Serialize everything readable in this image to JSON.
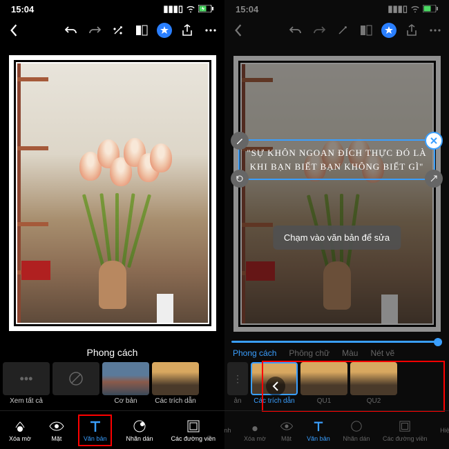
{
  "left": {
    "status": {
      "time": "15:04"
    },
    "section_title": "Phong cách",
    "styles": [
      {
        "label": "Xem tất cả",
        "icon": "···"
      },
      {
        "label": "",
        "icon": "⊘"
      },
      {
        "label": "Cơ bản"
      },
      {
        "label": "Các trích dẫn"
      }
    ],
    "nav": {
      "xoamo": "Xóa mờ",
      "mat": "Mặt",
      "vanban": "Văn bản",
      "nhandan": "Nhãn dán",
      "duongvien": "Các đường viền"
    }
  },
  "right": {
    "status": {
      "time": "15:04"
    },
    "quote": "\"SỰ KHÔN NGOAN ĐÍCH THỰC ĐÓ LÀ KHI BẠN BIẾT BẠN KHÔNG BIẾT GÌ\"",
    "tooltip": "Chạm vào văn bản để sửa",
    "tabs": {
      "phongcach": "Phong cách",
      "phongchu": "Phông chữ",
      "mau": "Màu",
      "netve": "Nét vẽ"
    },
    "styles": [
      {
        "label": "ản"
      },
      {
        "label": "Các trích dẫn"
      },
      {
        "label": "QU1"
      },
      {
        "label": "QU2"
      }
    ],
    "nav": {
      "nh": "nh",
      "xoamo": "Xóa mờ",
      "mat": "Mặt",
      "vanban": "Văn bản",
      "nhandan": "Nhãn dán",
      "duongvien": "Các đường viền",
      "hie": "Hiệ"
    }
  }
}
